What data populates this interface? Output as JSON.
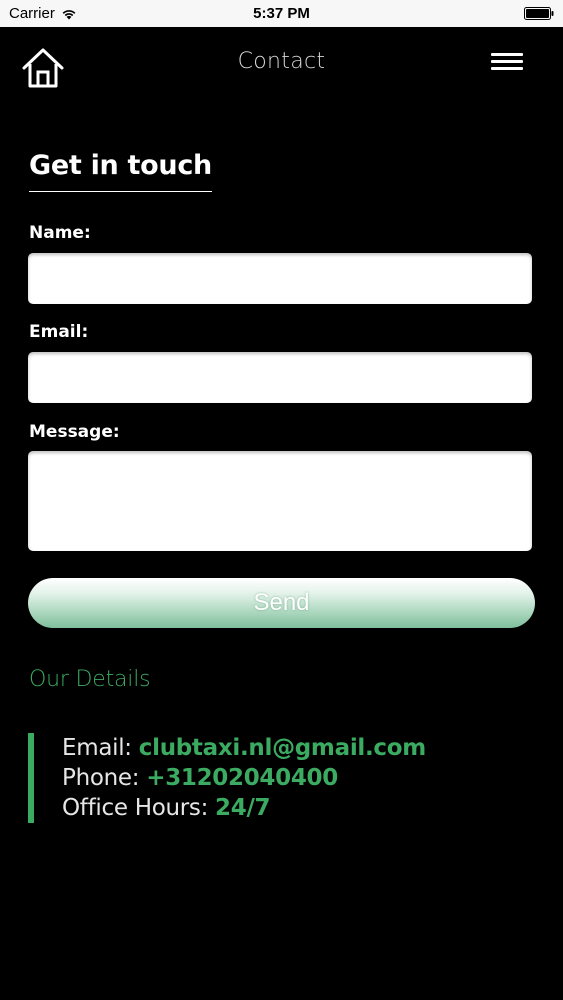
{
  "status_bar": {
    "carrier": "Carrier",
    "time": "5:37 PM"
  },
  "nav": {
    "title": "Contact",
    "home_icon": "home-icon",
    "menu_icon": "hamburger-menu-icon"
  },
  "form": {
    "heading": "Get in touch",
    "name_label": "Name:",
    "name_value": "",
    "email_label": "Email:",
    "email_value": "",
    "message_label": "Message:",
    "message_value": "",
    "send_label": "Send"
  },
  "details": {
    "heading": "Our Details",
    "email_label": "Email:",
    "email_value": "clubtaxi.nl@gmail.com",
    "phone_label": "Phone:",
    "phone_value": "+31202040400",
    "hours_label": "Office Hours:",
    "hours_value": "24/7"
  },
  "colors": {
    "accent": "#3cab62",
    "background": "#000000",
    "status_bar": "#f7f7f7"
  }
}
